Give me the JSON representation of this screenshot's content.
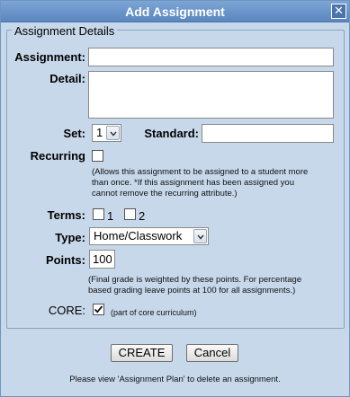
{
  "dialog": {
    "title": "Add Assignment",
    "close_glyph": "✕"
  },
  "form": {
    "legend": "Assignment Details",
    "assignment_label": "Assignment:",
    "assignment_value": "",
    "detail_label": "Detail:",
    "detail_value": "",
    "set_label": "Set:",
    "set_value": "1",
    "standard_label": "Standard:",
    "standard_value": "",
    "recurring_label": "Recurring",
    "recurring_checked": false,
    "recurring_note_line1": "(Allows this assignment to be assigned to a student more",
    "recurring_note_line2": "than once. *If this assignment has been assigned you",
    "recurring_note_line3": "cannot remove the recurring attribute.)",
    "terms_label": "Terms:",
    "terms": [
      {
        "label": "1",
        "checked": false
      },
      {
        "label": "2",
        "checked": false
      }
    ],
    "type_label": "Type:",
    "type_value": "Home/Classwork",
    "points_label": "Points:",
    "points_value": "100",
    "points_note_line1": "(Final grade is weighted by these points. For percentage",
    "points_note_line2": "based grading leave points at 100 for all assignments.)",
    "core_label": "CORE:",
    "core_checked": true,
    "core_note": "(part of core curriculum)"
  },
  "buttons": {
    "create_label": "CREATE",
    "cancel_label": "Cancel"
  },
  "footer": {
    "message": "Please view 'Assignment Plan' to delete an assignment."
  },
  "colors": {
    "dialog_bg": "#c7d8ea",
    "titlebar": "#6b94c9",
    "title_text": "#ffffff"
  },
  "icons": {
    "close": "close-icon",
    "dropdown": "chevron-down-icon",
    "check": "checkmark-icon"
  }
}
